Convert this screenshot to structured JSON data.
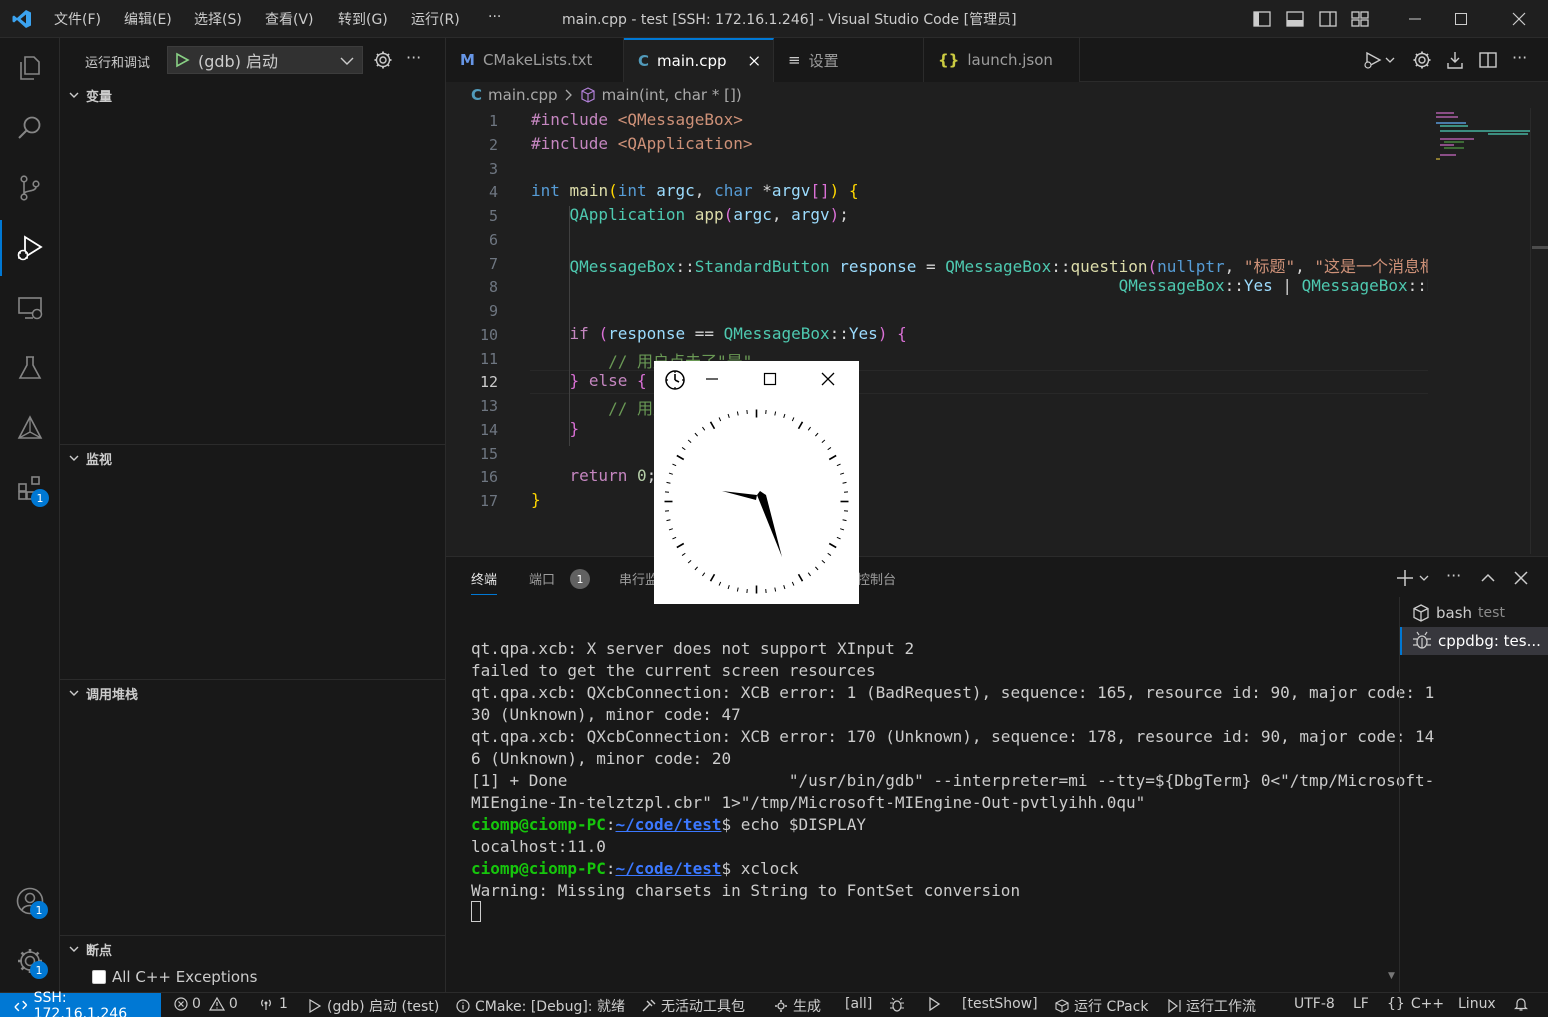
{
  "titlebar": {
    "menus": [
      "文件(F)",
      "编辑(E)",
      "选择(S)",
      "查看(V)",
      "转到(G)",
      "运行(R)",
      "···"
    ],
    "title": "main.cpp - test [SSH: 172.16.1.246] - Visual Studio Code [管理员]"
  },
  "activitybar": {
    "extensions_badge": "1",
    "accounts_badge": "1",
    "settings_badge": "1"
  },
  "sidebar": {
    "header_label": "运行和调试",
    "config_label": "(gdb) 启动",
    "variables": "变量",
    "watch": "监视",
    "callstack": "调用堆栈",
    "breakpoints": "断点",
    "bp_all_cpp": "All C++ Exceptions"
  },
  "tabs": [
    {
      "label": "CMakeLists.txt",
      "icon": "M"
    },
    {
      "label": "main.cpp",
      "icon": "C"
    },
    {
      "label": "设置",
      "icon": "≡"
    },
    {
      "label": "launch.json",
      "icon": "{}"
    }
  ],
  "breadcrumb": {
    "file": "main.cpp",
    "symbol": "main(int, char * [])"
  },
  "editor": {
    "line_numbers": [
      "1",
      "2",
      "3",
      "4",
      "5",
      "6",
      "7",
      "8",
      "9",
      "10",
      "11",
      "12",
      "13",
      "14",
      "15",
      "16",
      "17"
    ],
    "active_line": "12"
  },
  "panel": {
    "tabs": [
      "终端",
      "端口",
      "串行监视器",
      "调试控制台"
    ],
    "ports_badge": "1",
    "terminals": [
      {
        "name": "bash",
        "detail": "test"
      },
      {
        "name": "cppdbg: tes..."
      }
    ],
    "lines": [
      "qt.qpa.xcb: X server does not support XInput 2",
      "failed to get the current screen resources",
      "qt.qpa.xcb: QXcbConnection: XCB error: 1 (BadRequest), sequence: 165, resource id: 90, major code: 1",
      "30 (Unknown), minor code: 47",
      "qt.qpa.xcb: QXcbConnection: XCB error: 170 (Unknown), sequence: 178, resource id: 90, major code: 14",
      "6 (Unknown), minor code: 20",
      "[1] + Done                       \"/usr/bin/gdb\" --interpreter=mi --tty=${DbgTerm} 0<\"/tmp/Microsoft-",
      "MIEngine-In-telztzpl.cbr\" 1>\"/tmp/Microsoft-MIEngine-Out-pvtlyihh.0qu\""
    ],
    "prompt_user": "ciomp@ciomp-PC",
    "prompt_path": "~/code/test",
    "cmd1": "echo $DISPLAY",
    "out1": "localhost:11.0",
    "cmd2": "xclock",
    "out2": "Warning: Missing charsets in String to FontSet conversion"
  },
  "statusbar": {
    "remote": "SSH: 172.16.1.246",
    "errors": "0",
    "warnings": "0",
    "ports": "1",
    "debug_config": "(gdb) 启动 (test)",
    "cmake": "CMake: [Debug]: 就绪",
    "kit": "无活动工具包",
    "build": "生成",
    "target": "[all]",
    "launch_target": "[testShow]",
    "cpack": "运行 CPack",
    "workflow": "运行工作流",
    "encoding": "UTF-8",
    "eol": "LF",
    "language": "C++",
    "os": "Linux"
  },
  "colors": {
    "accent": "#0078d4",
    "background": "#1f1f1f",
    "sidebar": "#181818"
  }
}
